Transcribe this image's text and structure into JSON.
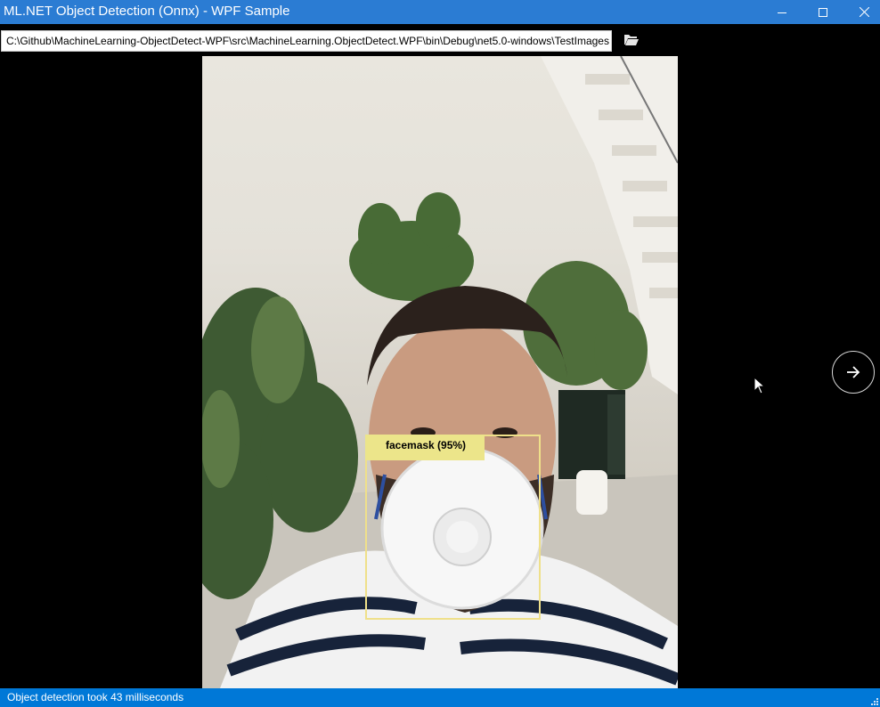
{
  "window": {
    "title": "ML.NET Object Detection (Onnx) - WPF Sample",
    "controls": [
      "minimize-icon",
      "maximize-icon",
      "close-icon"
    ]
  },
  "toolbar": {
    "path_value": "C:\\Github\\MachineLearning-ObjectDetect-WPF\\src\\MachineLearning.ObjectDetect.WPF\\bin\\Debug\\net5.0-windows\\TestImages",
    "folder_icon": "folder-open-icon"
  },
  "viewer": {
    "detection_label": "facemask (95%)",
    "detection_color": "#efe08a",
    "next_icon": "arrow-right-icon"
  },
  "status": {
    "text": "Object detection took 43 milliseconds"
  },
  "colors": {
    "titlebar": "#2b7cd3",
    "statusbar": "#0078d7",
    "background": "#000000"
  }
}
